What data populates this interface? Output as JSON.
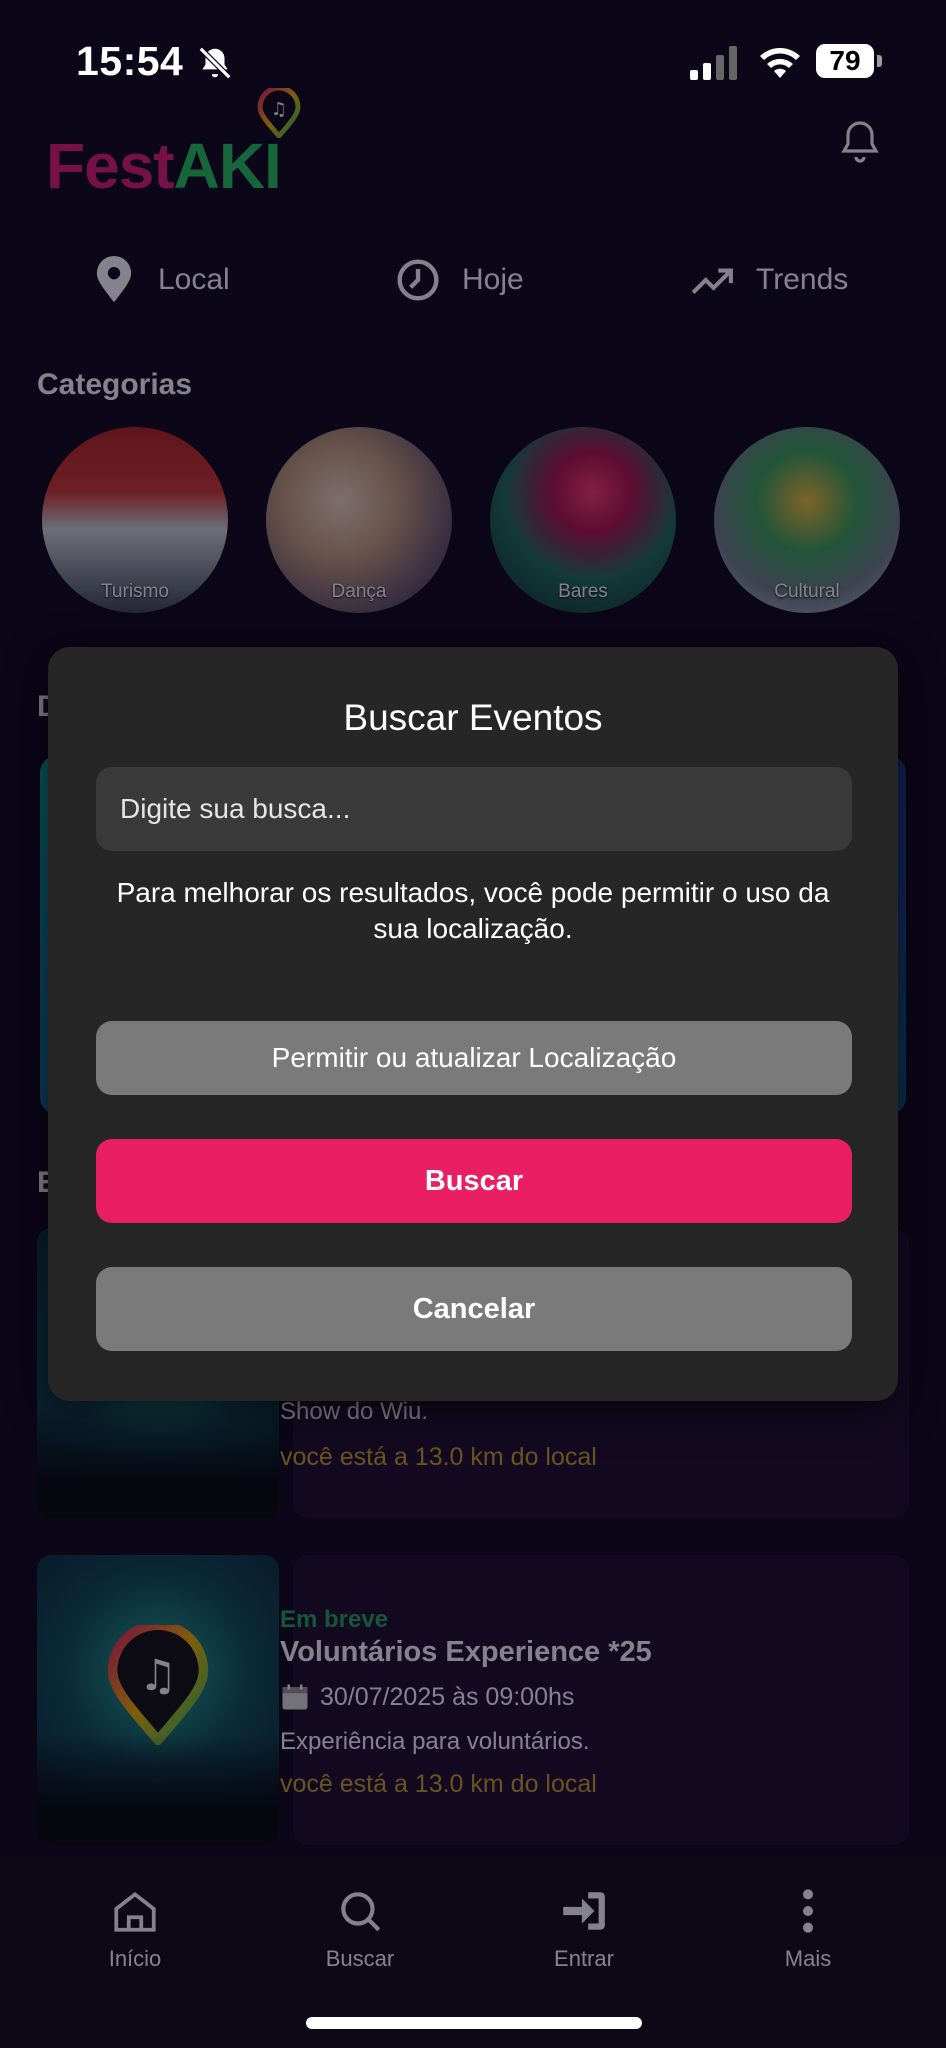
{
  "status_bar": {
    "time": "15:54",
    "battery": "79"
  },
  "header": {
    "logo_part1": "Fest",
    "logo_part2": "AKI"
  },
  "quick_filters": [
    {
      "label": "Local",
      "icon": "location-pin-icon"
    },
    {
      "label": "Hoje",
      "icon": "clock-icon"
    },
    {
      "label": "Trends",
      "icon": "trending-up-icon"
    }
  ],
  "categories": {
    "title": "Categorias",
    "items": [
      {
        "label": "Turismo"
      },
      {
        "label": "Dança"
      },
      {
        "label": "Bares"
      },
      {
        "label": "Cultural"
      }
    ]
  },
  "sections": {
    "featured_initial": "D",
    "events_initial": "E"
  },
  "events": [
    {
      "description": "Show do Wiu.",
      "distance": "você está a 13.0 km do local"
    },
    {
      "badge": "Em breve",
      "title": "Voluntários Experience *25",
      "date": "30/07/2025 às 09:00hs",
      "description": "Experiência para voluntários.",
      "distance": "você está a 13.0 km do local"
    }
  ],
  "modal": {
    "title": "Buscar Eventos",
    "search_placeholder": "Digite sua busca...",
    "message": "Para melhorar os resultados, você pode permitir o uso da sua localização.",
    "location_button": "Permitir ou atualizar Localização",
    "search_button": "Buscar",
    "cancel_button": "Cancelar"
  },
  "tabbar": [
    {
      "label": "Início",
      "icon": "home-icon"
    },
    {
      "label": "Buscar",
      "icon": "search-icon"
    },
    {
      "label": "Entrar",
      "icon": "login-icon"
    },
    {
      "label": "Mais",
      "icon": "more-vertical-icon"
    }
  ],
  "colors": {
    "brand_pink": "#e91e63",
    "brand_green": "#22c55e",
    "distance": "#c9a227",
    "badge": "#1ea85a"
  }
}
